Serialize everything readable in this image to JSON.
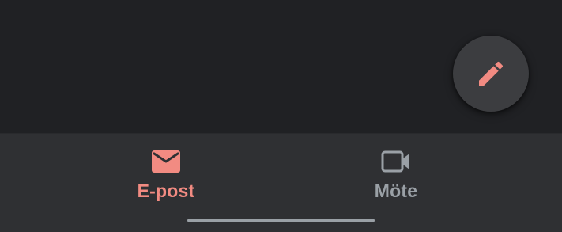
{
  "fab": {
    "icon": "pencil-icon",
    "accent_color": "#f28b82"
  },
  "bottom_nav": {
    "items": [
      {
        "label": "E-post",
        "icon": "mail-icon",
        "active": true,
        "color": "#f28b82"
      },
      {
        "label": "Möte",
        "icon": "video-camera-icon",
        "active": false,
        "color": "#9aa0a6"
      }
    ]
  },
  "colors": {
    "background": "#202124",
    "nav_background": "#2f3033",
    "fab_background": "#3c3d40"
  }
}
